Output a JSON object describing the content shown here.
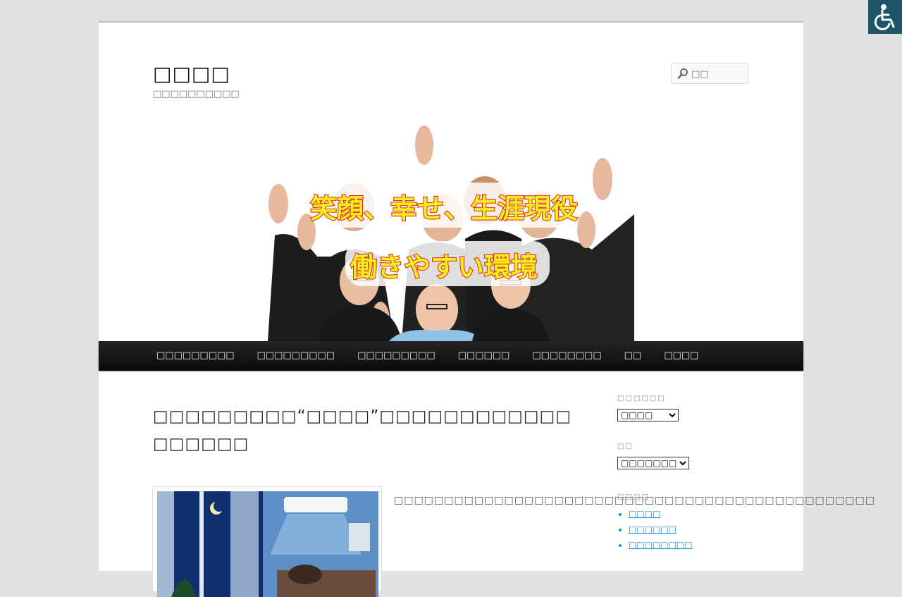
{
  "site": {
    "title": "□□□□",
    "description": "□□□□□□□□□□"
  },
  "search": {
    "placeholder": "□□"
  },
  "banner": {
    "line1": "笑顔、幸せ、生涯現役",
    "line2": "働きやすい環境"
  },
  "nav": {
    "items": [
      {
        "label": "□□□□□□□□□"
      },
      {
        "label": "□□□□□□□□□"
      },
      {
        "label": "□□□□□□□□□"
      },
      {
        "label": "□□□□□□"
      },
      {
        "label": "□□□□□□□□"
      },
      {
        "label": "□□"
      },
      {
        "label": "□□□□"
      }
    ]
  },
  "post": {
    "title_line1": "□□□□□□□□□“□□□□”□□□□□□□□□□□□",
    "title_line2": "□□□□□□",
    "excerpt": "□□□□□□□□□□□□□□□□□□□□□□□□□□□□□□□□□□□□□□□□□□□□□□□□"
  },
  "sidebar": {
    "widget1": {
      "title": "□□□□□□",
      "selected": "□□□□"
    },
    "widget2": {
      "title": "□□",
      "selected": "□□□□□□□□□"
    },
    "widget3": {
      "title": "□□□□",
      "links": [
        "□□□□",
        "□□□□□□",
        "□□□□□□□□"
      ]
    }
  },
  "colors": {
    "background": "#e2e2e2",
    "nav": "#111111",
    "link": "#1b8be0",
    "accessibility_button": "#1f5468"
  },
  "icons": {
    "search": "magnifier-icon",
    "accessibility": "wheelchair-icon"
  }
}
